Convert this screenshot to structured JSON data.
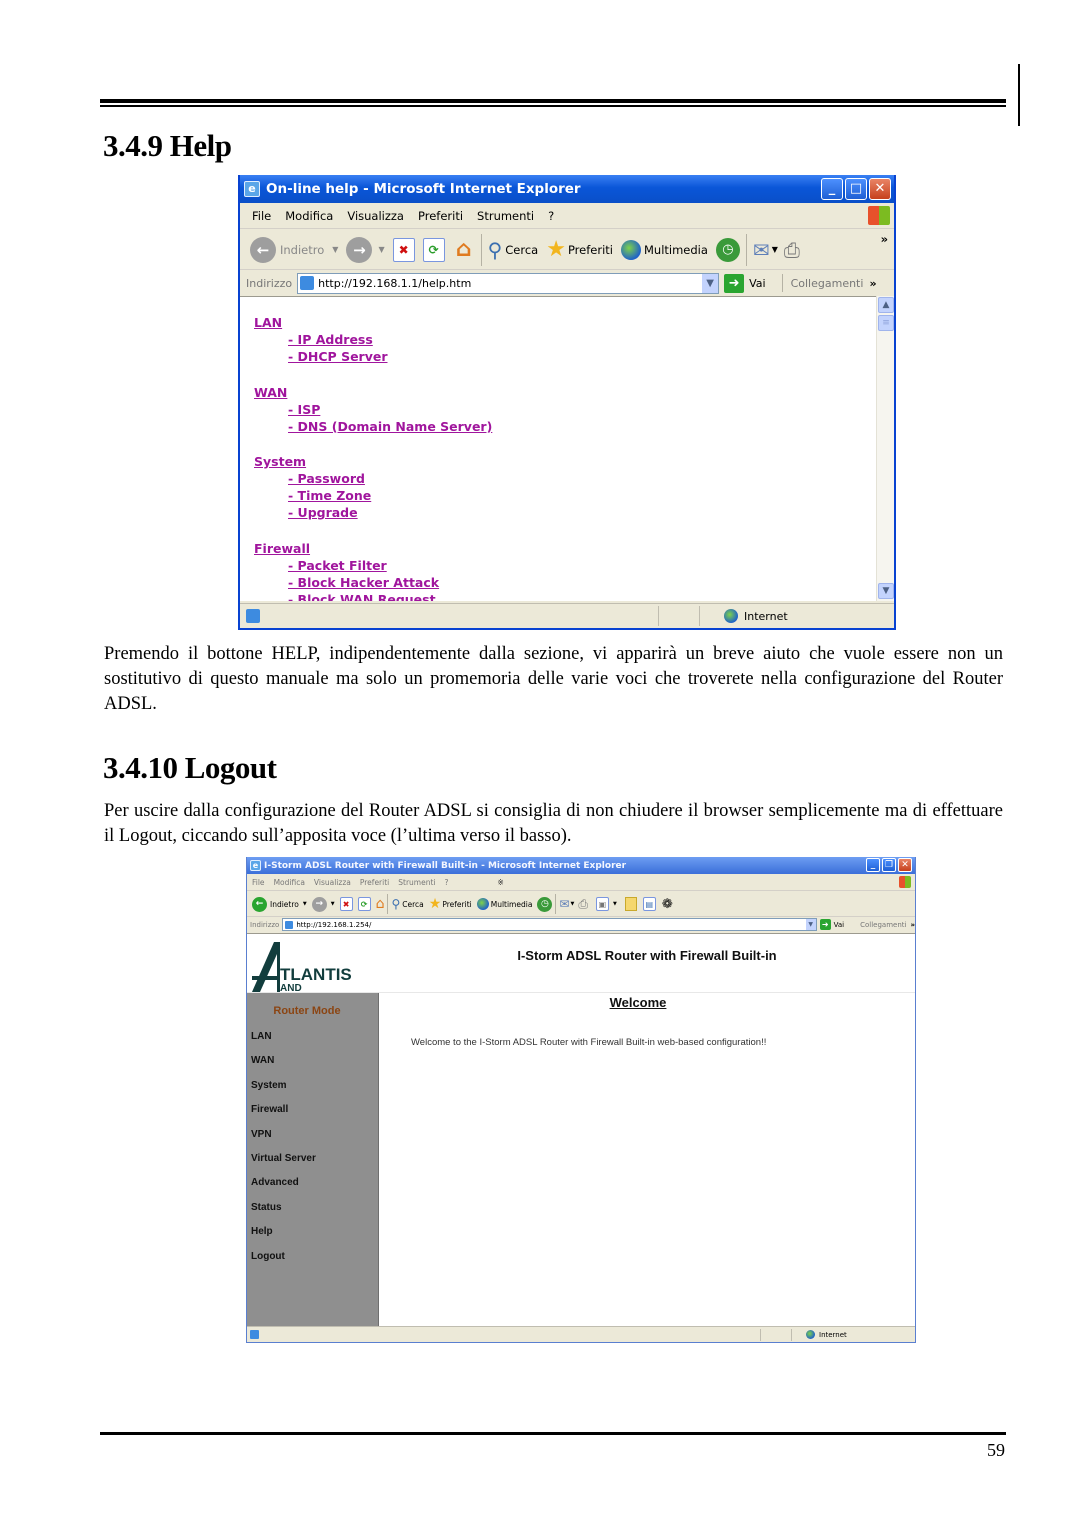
{
  "page": {
    "section1_title": "3.4.9 Help",
    "section1_text": "Premendo il bottone HELP, indipendentemente dalla sezione, vi apparirà un breve aiuto che vuole essere non un sostitutivo di questo manuale ma solo un promemoria delle varie voci che troverete nella configurazione del Router ADSL.",
    "section2_title": "3.4.10 Logout",
    "section2_text": "Per uscire dalla configurazione del Router ADSL si consiglia di non chiudere il browser semplicemente ma di effettuare il Logout, ciccando sull’apposita voce (l’ultima verso il basso).",
    "page_number": "59"
  },
  "help_window": {
    "title": "On-line help - Microsoft Internet Explorer",
    "menu": [
      "File",
      "Modifica",
      "Visualizza",
      "Preferiti",
      "Strumenti",
      "?"
    ],
    "toolbar": {
      "back": "Indietro",
      "search": "Cerca",
      "favorites": "Preferiti",
      "media": "Multimedia"
    },
    "address_label": "Indirizzo",
    "address_value": "http://192.168.1.1/help.htm",
    "go_label": "Vai",
    "links_label": "Collegamenti",
    "status_zone": "Internet",
    "link_color": "#a0159d",
    "help_sections": [
      {
        "title": "LAN",
        "items": [
          "- IP Address",
          "- DHCP Server"
        ]
      },
      {
        "title": "WAN",
        "items": [
          "- ISP",
          "- DNS (Domain Name Server)"
        ]
      },
      {
        "title": "System",
        "items": [
          "- Password",
          "- Time Zone",
          "- Upgrade"
        ]
      },
      {
        "title": "Firewall",
        "items": [
          "- Packet Filter",
          "- Block Hacker Attack",
          "- Block WAN Request"
        ]
      }
    ]
  },
  "router_window": {
    "title": "I-Storm ADSL Router with Firewall Built-in - Microsoft Internet Explorer",
    "menu": [
      "File",
      "Modifica",
      "Visualizza",
      "Preferiti",
      "Strumenti",
      "?"
    ],
    "toolbar": {
      "back": "Indietro",
      "search": "Cerca",
      "favorites": "Preferiti",
      "media": "Multimedia"
    },
    "address_label": "Indirizzo",
    "address_value": "http://192.168.1.254/",
    "go_label": "Vai",
    "links_label": "Collegamenti",
    "status_zone": "Internet",
    "logo_text": "TLANTIS",
    "logo_sub": "AND",
    "header_title": "I-Storm ADSL Router with Firewall Built-in",
    "mode_label": "Router Mode",
    "nav": [
      "LAN",
      "WAN",
      "System",
      "Firewall",
      "VPN",
      "Virtual Server",
      "Advanced",
      "Status",
      "Help",
      "Logout"
    ],
    "welcome_title": "Welcome",
    "welcome_message": "Welcome to the I-Storm ADSL Router with Firewall Built-in web-based configuration!!"
  }
}
